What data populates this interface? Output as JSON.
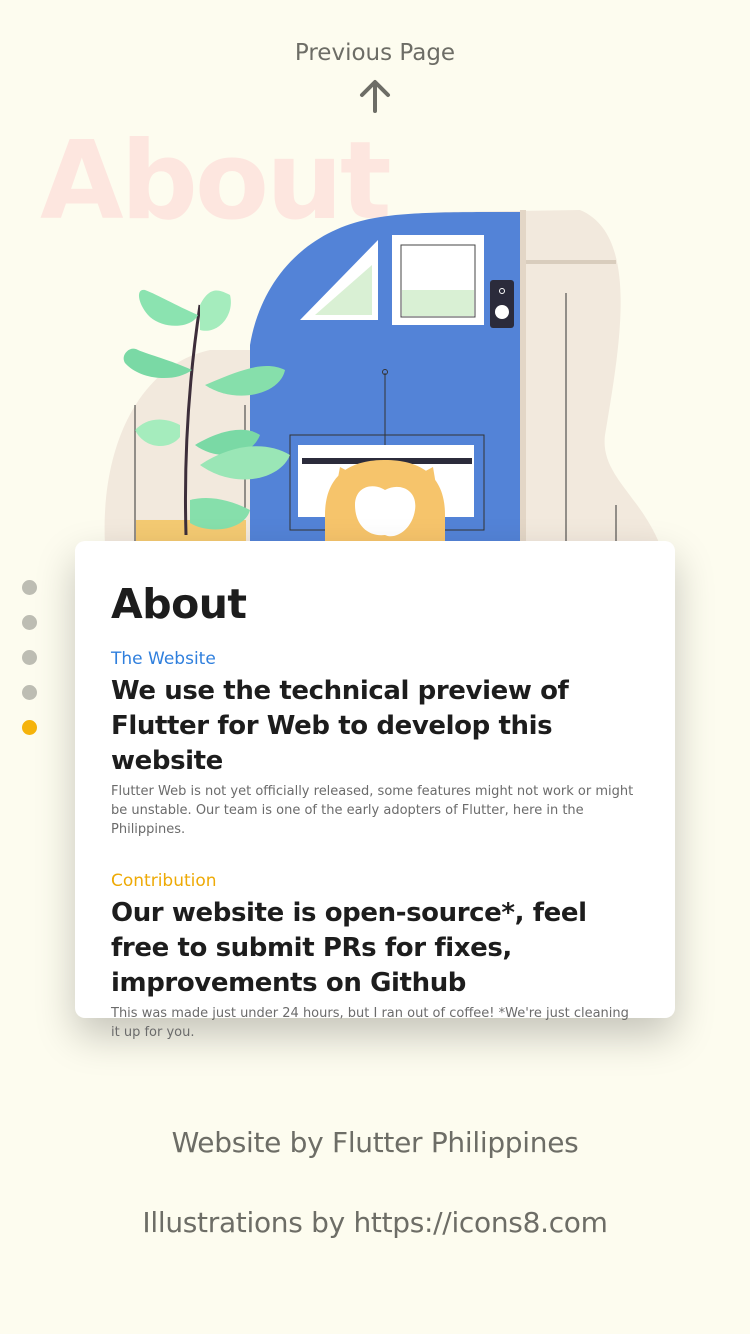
{
  "nav": {
    "previous_label": "Previous Page",
    "arrow_icon": "arrow-up-icon"
  },
  "hero": {
    "background_title": "About"
  },
  "pagination": {
    "dot_count": 5,
    "active_index": 4,
    "active_color": "#f5b30b",
    "inactive_color": "#bdbdb3"
  },
  "card": {
    "title": "About",
    "sections": [
      {
        "tag": "The Website",
        "tag_color": "#2f7fdd",
        "headline": "We use the technical preview of Flutter for Web to develop this website",
        "description": "Flutter Web is not yet officially released, some features might not work or might be unstable. Our team is one of the early adopters of Flutter, here in the Philippines."
      },
      {
        "tag": "Contribution",
        "tag_color": "#eeaa06",
        "headline": "Our website is open-source*, feel free to submit PRs for fixes, improvements on Github",
        "description": "This was made just under 24 hours, but I ran out of coffee! *We're just cleaning it up for you."
      }
    ]
  },
  "footer": {
    "credit": "Website by Flutter Philippines",
    "illustrations": "Illustrations by https://icons8.com"
  }
}
